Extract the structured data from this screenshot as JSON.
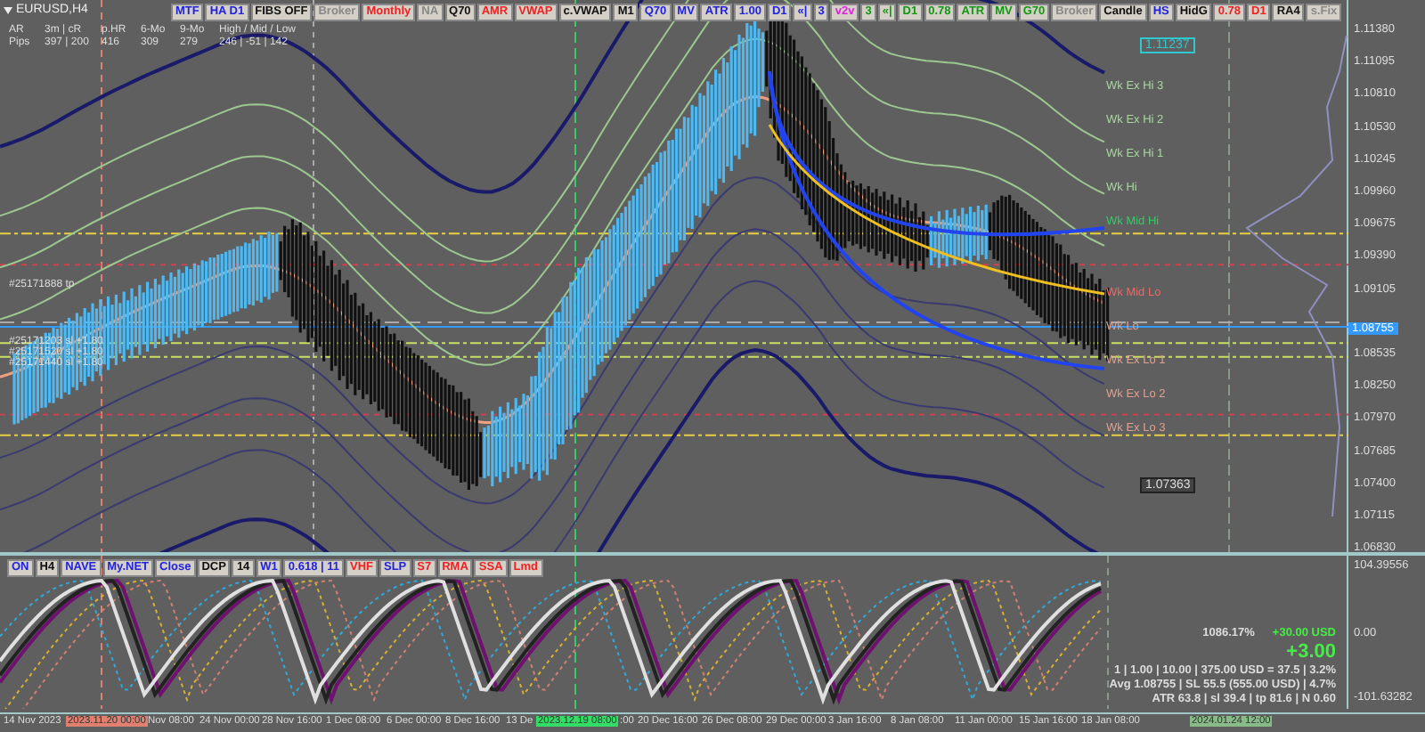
{
  "chart": {
    "symbol": "EURUSD,H4",
    "toolbar": [
      {
        "label": "MTF",
        "color": "#2222dd"
      },
      {
        "label": "HA D1",
        "color": "#2222dd"
      },
      {
        "label": "FIBS OFF",
        "color": "#111111"
      },
      {
        "label": "Broker",
        "color": "#888888"
      },
      {
        "label": "Monthly",
        "color": "#ee2222"
      },
      {
        "label": "NA",
        "color": "#888888"
      },
      {
        "label": "Q70",
        "color": "#111111"
      },
      {
        "label": "AMR",
        "color": "#ee2222"
      },
      {
        "label": "VWAP",
        "color": "#ee2222"
      },
      {
        "label": "c.VWAP",
        "color": "#111111"
      },
      {
        "label": "M1",
        "color": "#111111"
      },
      {
        "label": "Q70",
        "color": "#2222dd"
      },
      {
        "label": "MV",
        "color": "#2222dd"
      },
      {
        "label": "ATR",
        "color": "#2222dd"
      },
      {
        "label": "1.00",
        "color": "#2222dd"
      },
      {
        "label": "D1",
        "color": "#2222dd"
      },
      {
        "label": "«|",
        "color": "#2222dd"
      },
      {
        "label": "3",
        "color": "#2222dd"
      },
      {
        "label": "v2v",
        "color": "#dd22dd"
      },
      {
        "label": "3",
        "color": "#119911"
      },
      {
        "label": "«|",
        "color": "#119911"
      },
      {
        "label": "D1",
        "color": "#119911"
      },
      {
        "label": "0.78",
        "color": "#119911"
      },
      {
        "label": "ATR",
        "color": "#119911"
      },
      {
        "label": "MV",
        "color": "#119911"
      },
      {
        "label": "G70",
        "color": "#119911"
      },
      {
        "label": "Broker",
        "color": "#888888"
      },
      {
        "label": "Candle",
        "color": "#111111"
      },
      {
        "label": "HS",
        "color": "#2222dd"
      },
      {
        "label": "HidG",
        "color": "#111111"
      },
      {
        "label": "0.78",
        "color": "#ee2222"
      },
      {
        "label": "D1",
        "color": "#ee2222"
      },
      {
        "label": "RA4",
        "color": "#111111"
      },
      {
        "label": "s.Fix",
        "color": "#888888"
      }
    ],
    "stats": {
      "header": [
        "AR",
        "3m | cR",
        "p.HR",
        "6-Mo",
        "9-Mo",
        "High / Mid / Low"
      ],
      "row": [
        "Pips",
        "397 | 200",
        "416",
        "309",
        "279",
        "246 | -51 | 142"
      ]
    },
    "level_labels": [
      {
        "label": "Wk Ex Hi 3",
        "color": "#a8d8a0"
      },
      {
        "label": "Wk Ex Hi 2",
        "color": "#a8d8a0"
      },
      {
        "label": "Wk Ex Hi 1",
        "color": "#a8d8a0"
      },
      {
        "label": "Wk Hi",
        "color": "#a8d8a0"
      },
      {
        "label": "Wk Mid Hi",
        "color": "#33cc66"
      },
      {
        "label": "Wk Mid Lo",
        "color": "#ee6666"
      },
      {
        "label": "Wk Lo",
        "color": "#e0a090"
      },
      {
        "label": "Wk Ex Lo 1",
        "color": "#e0a090"
      },
      {
        "label": "Wk Ex Lo 2",
        "color": "#e0a090"
      },
      {
        "label": "Wk Ex Lo 3",
        "color": "#e0a090"
      }
    ],
    "order_labels": [
      "#25171888 tp",
      "#25171203 sl +1.80",
      "#25171520 sl +1.80",
      "#25171440 sl +1.80"
    ],
    "price_boxes": [
      {
        "label": "1.11237",
        "kind": "high"
      },
      {
        "label": "1.07363",
        "kind": "low"
      }
    ],
    "price_axis": [
      "1.11380",
      "1.11095",
      "1.10810",
      "1.10530",
      "1.10245",
      "1.09960",
      "1.09675",
      "1.09390",
      "1.09105",
      "1.08535",
      "1.08250",
      "1.07970",
      "1.07685",
      "1.07400",
      "1.07115",
      "1.06830"
    ],
    "current_price": "1.08755"
  },
  "oscillator": {
    "toolbar": [
      {
        "label": "ON",
        "color": "#2222dd"
      },
      {
        "label": "H4",
        "color": "#111111"
      },
      {
        "label": "NAVE",
        "color": "#2222dd"
      },
      {
        "label": "My.NET",
        "color": "#2222dd"
      },
      {
        "label": "Close",
        "color": "#2222dd"
      },
      {
        "label": "DCP",
        "color": "#111111"
      },
      {
        "label": "14",
        "color": "#111111"
      },
      {
        "label": "W1",
        "color": "#2222dd"
      },
      {
        "label": "0.618 | 11",
        "color": "#2222dd"
      },
      {
        "label": "VHF",
        "color": "#ee2222"
      },
      {
        "label": "SLP",
        "color": "#2222dd"
      },
      {
        "label": "S7",
        "color": "#ee2222"
      },
      {
        "label": "RMA",
        "color": "#ee2222"
      },
      {
        "label": "SSA",
        "color": "#ee2222"
      },
      {
        "label": "Lmd",
        "color": "#ee2222"
      }
    ],
    "axis": [
      "104.39556",
      "0.00",
      "-101.63282"
    ]
  },
  "trade_panel": {
    "equity": "1086.17%",
    "profit": "+30.00 USD",
    "pips": "+3.00",
    "lines": [
      "1 | 1.00 | 10.00 | 375.00 USD = 37.5 | 3.2%",
      "Avg 1.08755 | SL 55.5 (555.00 USD) | 4.7%",
      "ATR 63.8 | sl 39.4 | tp 81.6 | N 0.60"
    ]
  },
  "time_axis": {
    "labels": [
      "14 Nov 2023",
      "Nov 08:00",
      "24 Nov 00:00",
      "28 Nov 16:00",
      "1 Dec 08:00",
      "6 Dec 00:00",
      "8 Dec 16:00",
      "13 De",
      ":00",
      "20 Dec 16:00",
      "26 Dec 08:00",
      "29 Dec 00:00",
      "3 Jan 16:00",
      "8 Jan 08:00",
      "11 Jan 00:00",
      "15 Jan 16:00",
      "18 Jan 08:00"
    ],
    "markers": [
      {
        "label": "2023.11.20 00:00",
        "color": "#e08070"
      },
      {
        "label": "2023.12.19 08:00",
        "color": "#33dd66"
      },
      {
        "label": "2024.01.24 12:00",
        "color": "#88bb88"
      }
    ]
  }
}
